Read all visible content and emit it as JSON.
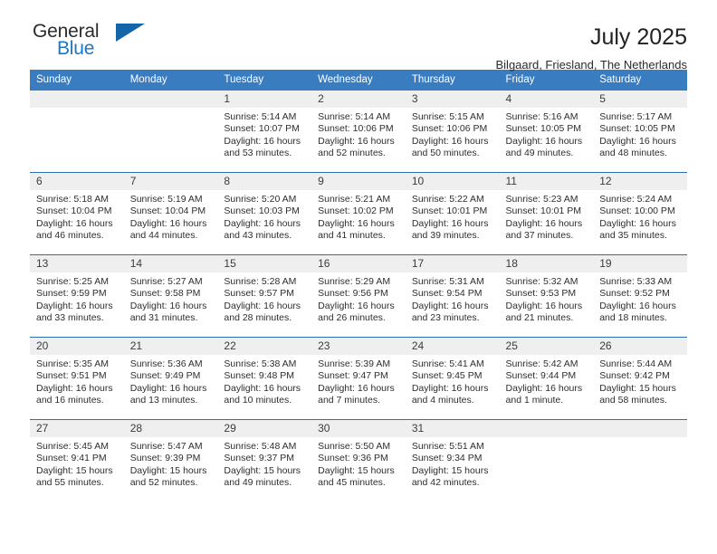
{
  "brand": {
    "name_top": "General",
    "name_bottom": "Blue",
    "accent_color": "#1a77c4",
    "triangle_color": "#1565ab"
  },
  "header": {
    "title": "July 2025",
    "subtitle": "Bilgaard, Friesland, The Netherlands"
  },
  "theme": {
    "header_row_bg": "#3a7cc0",
    "daynum_bg": "#efefef",
    "row_divider": "#2f6daf"
  },
  "weekday_headers": [
    "Sunday",
    "Monday",
    "Tuesday",
    "Wednesday",
    "Thursday",
    "Friday",
    "Saturday"
  ],
  "weeks": [
    [
      {
        "day": "",
        "sunrise": "",
        "sunset": "",
        "daylight": ""
      },
      {
        "day": "",
        "sunrise": "",
        "sunset": "",
        "daylight": ""
      },
      {
        "day": "1",
        "sunrise": "Sunrise: 5:14 AM",
        "sunset": "Sunset: 10:07 PM",
        "daylight": "Daylight: 16 hours and 53 minutes."
      },
      {
        "day": "2",
        "sunrise": "Sunrise: 5:14 AM",
        "sunset": "Sunset: 10:06 PM",
        "daylight": "Daylight: 16 hours and 52 minutes."
      },
      {
        "day": "3",
        "sunrise": "Sunrise: 5:15 AM",
        "sunset": "Sunset: 10:06 PM",
        "daylight": "Daylight: 16 hours and 50 minutes."
      },
      {
        "day": "4",
        "sunrise": "Sunrise: 5:16 AM",
        "sunset": "Sunset: 10:05 PM",
        "daylight": "Daylight: 16 hours and 49 minutes."
      },
      {
        "day": "5",
        "sunrise": "Sunrise: 5:17 AM",
        "sunset": "Sunset: 10:05 PM",
        "daylight": "Daylight: 16 hours and 48 minutes."
      }
    ],
    [
      {
        "day": "6",
        "sunrise": "Sunrise: 5:18 AM",
        "sunset": "Sunset: 10:04 PM",
        "daylight": "Daylight: 16 hours and 46 minutes."
      },
      {
        "day": "7",
        "sunrise": "Sunrise: 5:19 AM",
        "sunset": "Sunset: 10:04 PM",
        "daylight": "Daylight: 16 hours and 44 minutes."
      },
      {
        "day": "8",
        "sunrise": "Sunrise: 5:20 AM",
        "sunset": "Sunset: 10:03 PM",
        "daylight": "Daylight: 16 hours and 43 minutes."
      },
      {
        "day": "9",
        "sunrise": "Sunrise: 5:21 AM",
        "sunset": "Sunset: 10:02 PM",
        "daylight": "Daylight: 16 hours and 41 minutes."
      },
      {
        "day": "10",
        "sunrise": "Sunrise: 5:22 AM",
        "sunset": "Sunset: 10:01 PM",
        "daylight": "Daylight: 16 hours and 39 minutes."
      },
      {
        "day": "11",
        "sunrise": "Sunrise: 5:23 AM",
        "sunset": "Sunset: 10:01 PM",
        "daylight": "Daylight: 16 hours and 37 minutes."
      },
      {
        "day": "12",
        "sunrise": "Sunrise: 5:24 AM",
        "sunset": "Sunset: 10:00 PM",
        "daylight": "Daylight: 16 hours and 35 minutes."
      }
    ],
    [
      {
        "day": "13",
        "sunrise": "Sunrise: 5:25 AM",
        "sunset": "Sunset: 9:59 PM",
        "daylight": "Daylight: 16 hours and 33 minutes."
      },
      {
        "day": "14",
        "sunrise": "Sunrise: 5:27 AM",
        "sunset": "Sunset: 9:58 PM",
        "daylight": "Daylight: 16 hours and 31 minutes."
      },
      {
        "day": "15",
        "sunrise": "Sunrise: 5:28 AM",
        "sunset": "Sunset: 9:57 PM",
        "daylight": "Daylight: 16 hours and 28 minutes."
      },
      {
        "day": "16",
        "sunrise": "Sunrise: 5:29 AM",
        "sunset": "Sunset: 9:56 PM",
        "daylight": "Daylight: 16 hours and 26 minutes."
      },
      {
        "day": "17",
        "sunrise": "Sunrise: 5:31 AM",
        "sunset": "Sunset: 9:54 PM",
        "daylight": "Daylight: 16 hours and 23 minutes."
      },
      {
        "day": "18",
        "sunrise": "Sunrise: 5:32 AM",
        "sunset": "Sunset: 9:53 PM",
        "daylight": "Daylight: 16 hours and 21 minutes."
      },
      {
        "day": "19",
        "sunrise": "Sunrise: 5:33 AM",
        "sunset": "Sunset: 9:52 PM",
        "daylight": "Daylight: 16 hours and 18 minutes."
      }
    ],
    [
      {
        "day": "20",
        "sunrise": "Sunrise: 5:35 AM",
        "sunset": "Sunset: 9:51 PM",
        "daylight": "Daylight: 16 hours and 16 minutes."
      },
      {
        "day": "21",
        "sunrise": "Sunrise: 5:36 AM",
        "sunset": "Sunset: 9:49 PM",
        "daylight": "Daylight: 16 hours and 13 minutes."
      },
      {
        "day": "22",
        "sunrise": "Sunrise: 5:38 AM",
        "sunset": "Sunset: 9:48 PM",
        "daylight": "Daylight: 16 hours and 10 minutes."
      },
      {
        "day": "23",
        "sunrise": "Sunrise: 5:39 AM",
        "sunset": "Sunset: 9:47 PM",
        "daylight": "Daylight: 16 hours and 7 minutes."
      },
      {
        "day": "24",
        "sunrise": "Sunrise: 5:41 AM",
        "sunset": "Sunset: 9:45 PM",
        "daylight": "Daylight: 16 hours and 4 minutes."
      },
      {
        "day": "25",
        "sunrise": "Sunrise: 5:42 AM",
        "sunset": "Sunset: 9:44 PM",
        "daylight": "Daylight: 16 hours and 1 minute."
      },
      {
        "day": "26",
        "sunrise": "Sunrise: 5:44 AM",
        "sunset": "Sunset: 9:42 PM",
        "daylight": "Daylight: 15 hours and 58 minutes."
      }
    ],
    [
      {
        "day": "27",
        "sunrise": "Sunrise: 5:45 AM",
        "sunset": "Sunset: 9:41 PM",
        "daylight": "Daylight: 15 hours and 55 minutes."
      },
      {
        "day": "28",
        "sunrise": "Sunrise: 5:47 AM",
        "sunset": "Sunset: 9:39 PM",
        "daylight": "Daylight: 15 hours and 52 minutes."
      },
      {
        "day": "29",
        "sunrise": "Sunrise: 5:48 AM",
        "sunset": "Sunset: 9:37 PM",
        "daylight": "Daylight: 15 hours and 49 minutes."
      },
      {
        "day": "30",
        "sunrise": "Sunrise: 5:50 AM",
        "sunset": "Sunset: 9:36 PM",
        "daylight": "Daylight: 15 hours and 45 minutes."
      },
      {
        "day": "31",
        "sunrise": "Sunrise: 5:51 AM",
        "sunset": "Sunset: 9:34 PM",
        "daylight": "Daylight: 15 hours and 42 minutes."
      },
      {
        "day": "",
        "sunrise": "",
        "sunset": "",
        "daylight": ""
      },
      {
        "day": "",
        "sunrise": "",
        "sunset": "",
        "daylight": ""
      }
    ]
  ]
}
